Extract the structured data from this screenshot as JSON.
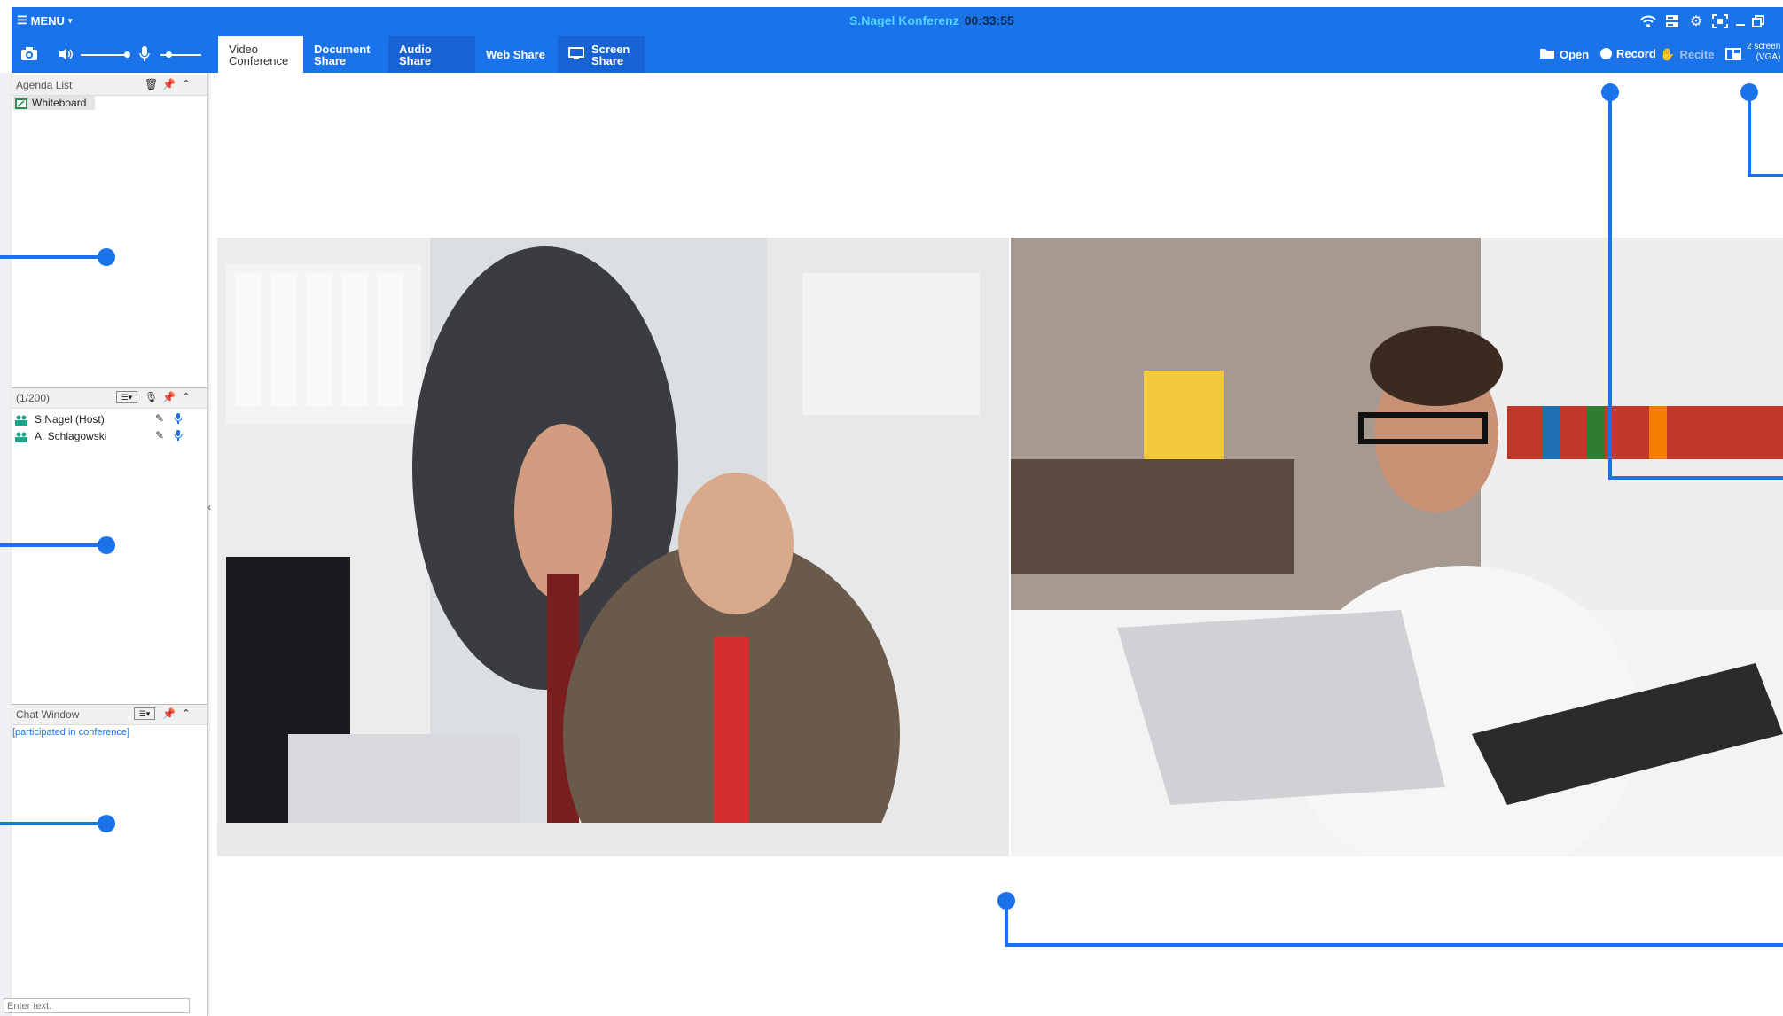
{
  "titlebar": {
    "menu_label": "MENU",
    "conference_name": "S.Nagel Konferenz",
    "elapsed_time": "00:33:55"
  },
  "toolbar": {
    "tabs": [
      {
        "label_line1": "Video",
        "label_line2": "Conference",
        "active": true
      },
      {
        "label_line1": "Document",
        "label_line2": "Share",
        "active": false
      },
      {
        "label_line1": "Audio Share",
        "label_line2": "",
        "active": false
      },
      {
        "label_line1": "Web Share",
        "label_line2": "",
        "active": false
      },
      {
        "label_line1": "Screen",
        "label_line2": "Share",
        "active": false
      }
    ],
    "open_label": "Open",
    "record_label": "Record",
    "recite_label": "Recite",
    "screen_mode_line1": "2 screen",
    "screen_mode_line2": "(VGA)"
  },
  "sidebar": {
    "agenda": {
      "title": "Agenda List",
      "items": [
        {
          "label": "Whiteboard"
        }
      ]
    },
    "participants": {
      "count_label": "(1/200)",
      "items": [
        {
          "name": "S.Nagel (Host)"
        },
        {
          "name": "A. Schlagowski"
        }
      ]
    },
    "chat": {
      "title": "Chat Window",
      "messages": [
        "[participated in conference]"
      ],
      "input_placeholder": "Enter text."
    }
  },
  "colors": {
    "accent": "#1a73e8",
    "title_name": "#4fd5ff",
    "chat_system": "#1a73e8"
  }
}
